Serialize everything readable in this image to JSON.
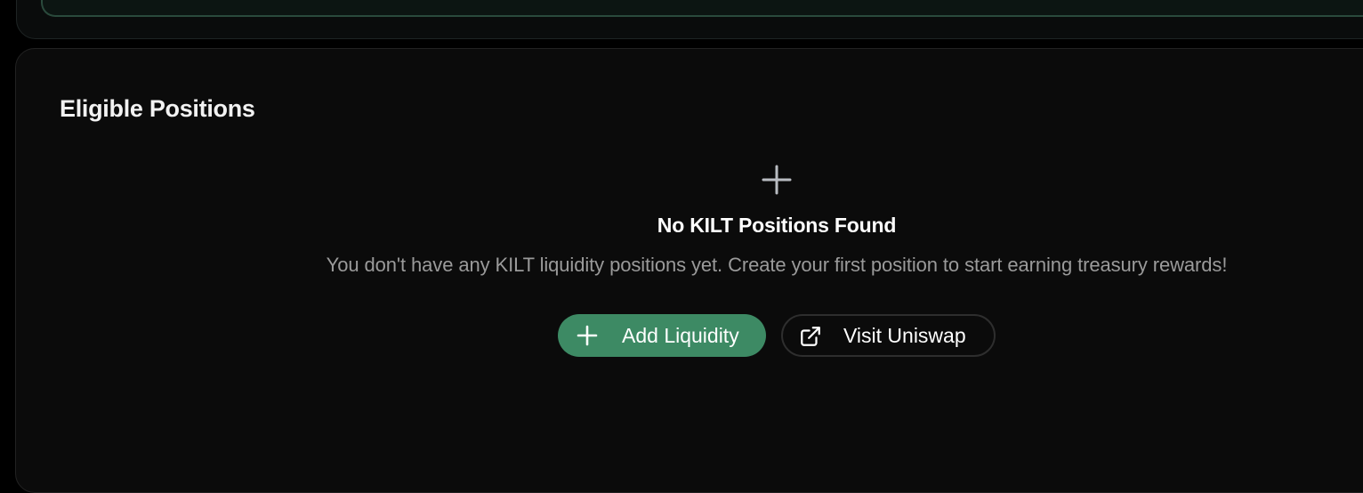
{
  "section": {
    "title": "Eligible Positions"
  },
  "empty_state": {
    "icon": "plus-icon",
    "title": "No KILT Positions Found",
    "description": "You don't have any KILT liquidity positions yet. Create your first position to start earning treasury rewards!"
  },
  "actions": {
    "add_liquidity_label": "Add Liquidity",
    "add_liquidity_icon": "plus-icon",
    "visit_uniswap_label": "Visit Uniswap",
    "visit_uniswap_icon": "external-link-icon"
  },
  "colors": {
    "background": "#000000",
    "card": "#0b0b0b",
    "accent": "#3d8a64",
    "muted_text": "#9a9a9a"
  }
}
